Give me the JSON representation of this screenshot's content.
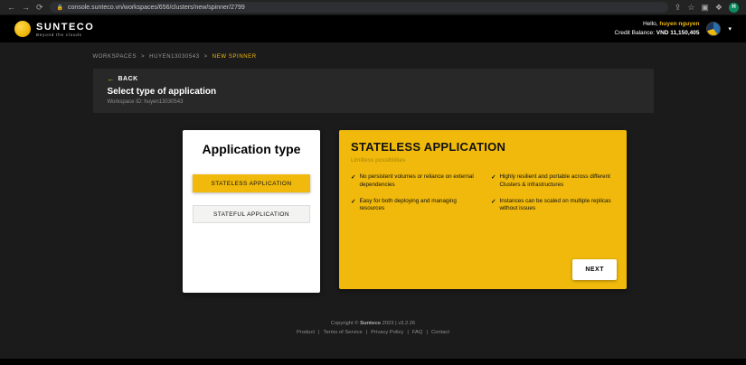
{
  "browser": {
    "url": "console.sunteco.vn/workspaces/656/clusters/new/spinner/2799",
    "back": "←",
    "forward": "→",
    "reload": "⟳",
    "lock": "🔒",
    "share": "⇪",
    "star": "☆",
    "panel": "▣",
    "apps": "❖",
    "profile_initial": "H"
  },
  "header": {
    "brand": "SUNTECO",
    "tagline": "Beyond the clouds",
    "greeting_prefix": "Hello,",
    "username": "huyen nguyen",
    "credit_label": "Credit Balance:",
    "credit_value": "VND 11,150,405",
    "caret": "▾"
  },
  "breadcrumb": {
    "separator": ">",
    "items": [
      {
        "label": "WORKSPACES"
      },
      {
        "label": "HUYEN13030543"
      },
      {
        "label": "NEW SPINNER"
      }
    ]
  },
  "page": {
    "back_arrow": "←",
    "back_label": "BACK",
    "title": "Select type of application",
    "workspace_id": "Workspace ID: huyen13030543"
  },
  "type_card": {
    "title": "Application type",
    "options": [
      {
        "label": "STATELESS APPLICATION"
      },
      {
        "label": "STATEFUL APPLICATION"
      }
    ]
  },
  "detail_card": {
    "title": "STATELESS APPLICATION",
    "subtitle": "Limitless possibilities",
    "check": "✓",
    "features": [
      "No persistent volumes or reliance on external dependencies",
      "Easy for both deploying and managing resources",
      "Highly resilient and portable across different Clusters & infrastructures",
      "Instances can be scaled on multiple replicas without issues"
    ],
    "next_label": "NEXT"
  },
  "footer": {
    "copyright_prefix": "Copyright ©",
    "brand": "Sunteco",
    "copyright_suffix": "2023 | v3.2.26",
    "separator": "|",
    "links": [
      "Product",
      "Terms of Service",
      "Privacy Policy",
      "FAQ",
      "Contact"
    ]
  },
  "colors": {
    "accent_yellow": "#f0b90b",
    "page_background": "#1b1b1b",
    "header_background": "#000000"
  }
}
